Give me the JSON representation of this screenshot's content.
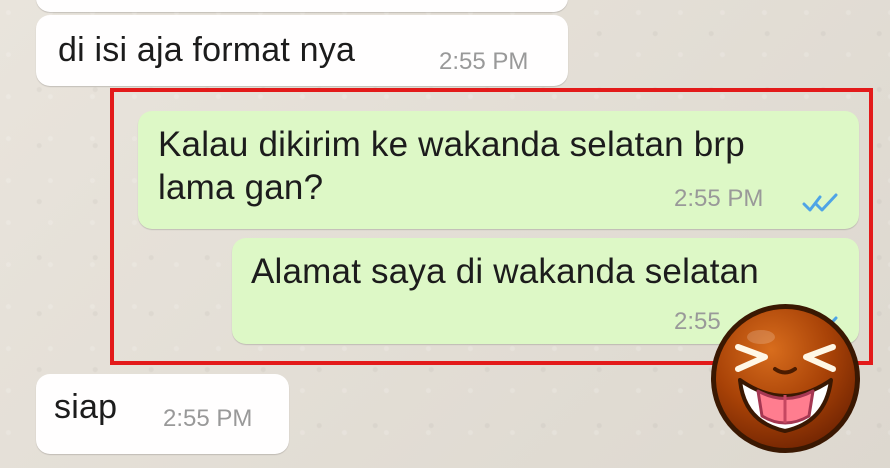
{
  "chat": {
    "messages": [
      {
        "id": "bubble-1",
        "text": "di isi aja format nya",
        "time": "2:55 PM"
      },
      {
        "id": "bubble-2",
        "text": "Kalau dikirim ke wakanda selatan brp\nlama gan?",
        "time": "2:55 PM"
      },
      {
        "id": "bubble-3",
        "text": "Alamat saya di wakanda selatan",
        "time": "2:55"
      },
      {
        "id": "bubble-4",
        "text": "siap",
        "time": "2:55 PM"
      }
    ]
  },
  "colors": {
    "incoming": "#fffefe",
    "outgoing": "#ddf8c6",
    "highlight": "#e31a1a",
    "ticks": "#4ea4e6",
    "timestamp": "#999999"
  },
  "icons": {
    "read_ticks": "double-check-icon",
    "sticker": "laughing-emoji-icon"
  }
}
